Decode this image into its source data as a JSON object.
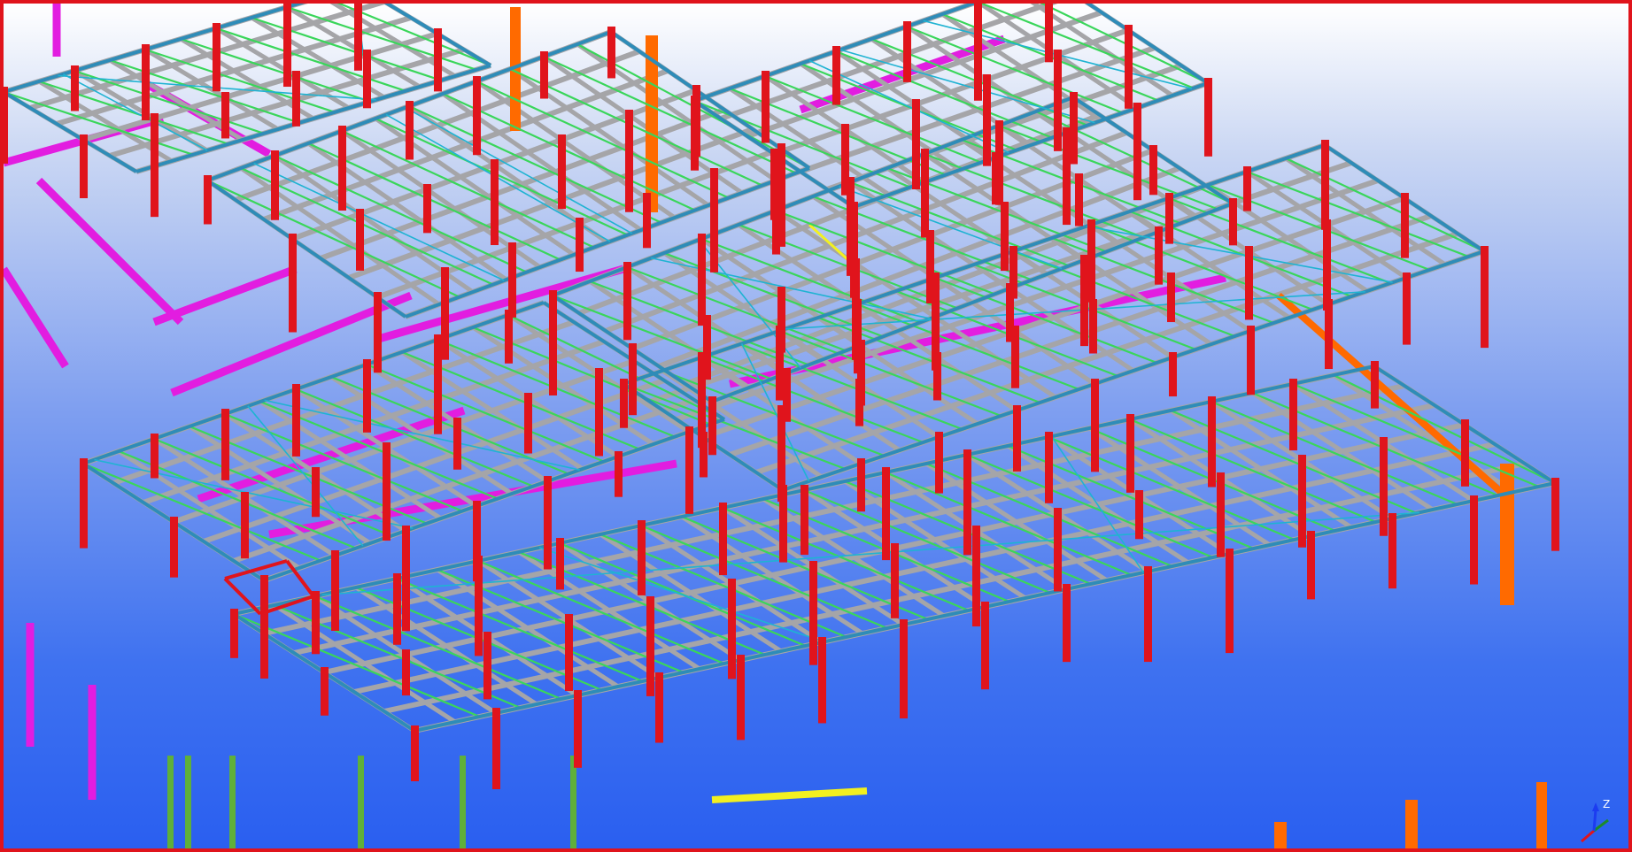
{
  "viewport": {
    "border_color": "#e0141c",
    "background_top": "#ffffff",
    "background_bottom": "#2a5ff0"
  },
  "legend_colors": {
    "column": "#e0141c",
    "beam": "#a5a5a8",
    "purlin": "#3ad65a",
    "edge_beam": "#2e8cb8",
    "bracing": "#1fb3d2",
    "secondary": "#e21de0",
    "special": "#ff6a00",
    "highlight": "#f2f020",
    "post": "#5fb03a"
  },
  "axis_gizmo": {
    "labels": {
      "z": "Z"
    },
    "colors": {
      "x": "#e0141c",
      "y": "#1c8a2a",
      "z": "#1c3cf0"
    }
  }
}
